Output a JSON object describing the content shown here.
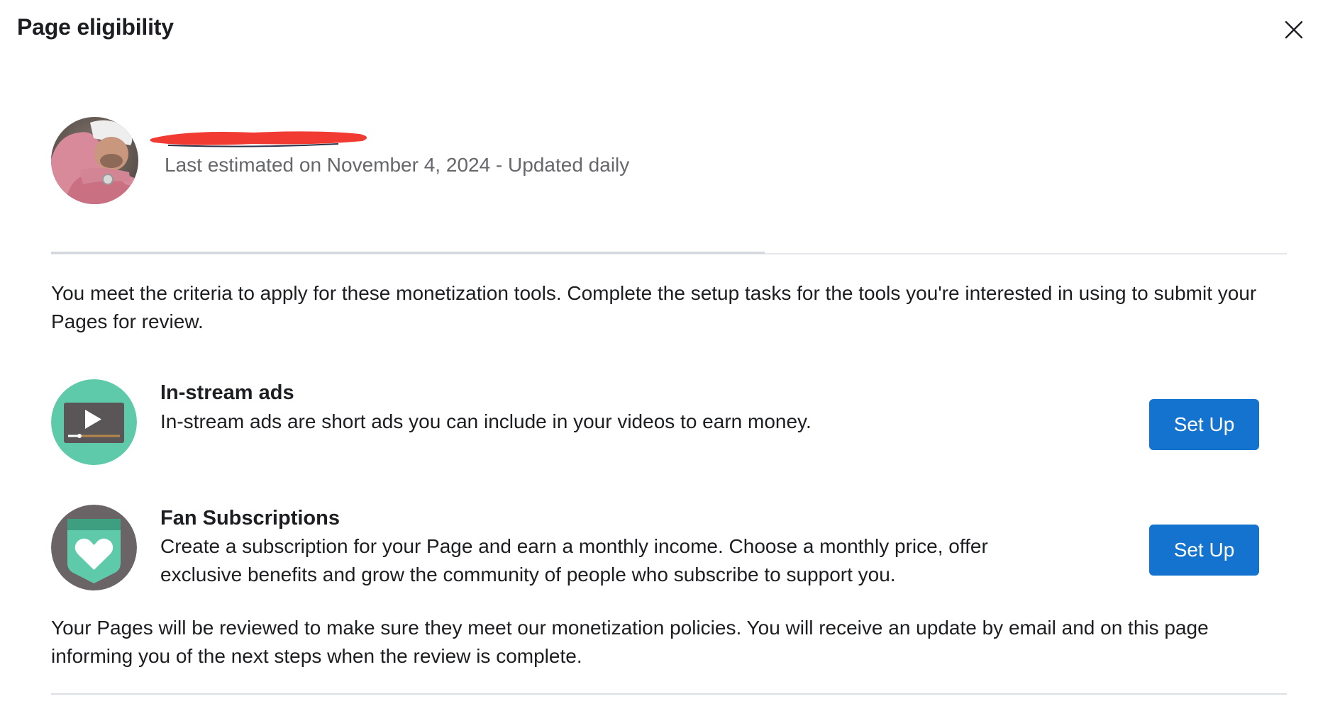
{
  "dialog": {
    "title": "Page eligibility",
    "close_icon": "close-icon"
  },
  "page": {
    "estimate_text": "Last estimated on November 4, 2024 - Updated daily"
  },
  "intro": "You meet the criteria to apply for these monetization tools. Complete the setup tasks for the tools you're interested in using to submit your Pages for review.",
  "tools": [
    {
      "title": "In-stream ads",
      "description": "In-stream ads are short ads you can include in your videos to earn money.",
      "button_label": "Set Up",
      "icon": "video-play-icon",
      "icon_bg": "#5fcaa9"
    },
    {
      "title": "Fan Subscriptions",
      "description": "Create a subscription for your Page and earn a monthly income. Choose a monthly price, offer exclusive benefits and grow the community of people who subscribe to support you.",
      "button_label": "Set Up",
      "icon": "heart-badge-icon",
      "icon_bg": "#6b6466"
    }
  ],
  "review_notice": "Your Pages will be reviewed to make sure they meet our monetization policies. You will receive an update by email and on this page informing you of the next steps when the review is complete.",
  "colors": {
    "button_bg": "#1473cf",
    "muted_text": "#65676b",
    "redaction": "#f03a32"
  }
}
